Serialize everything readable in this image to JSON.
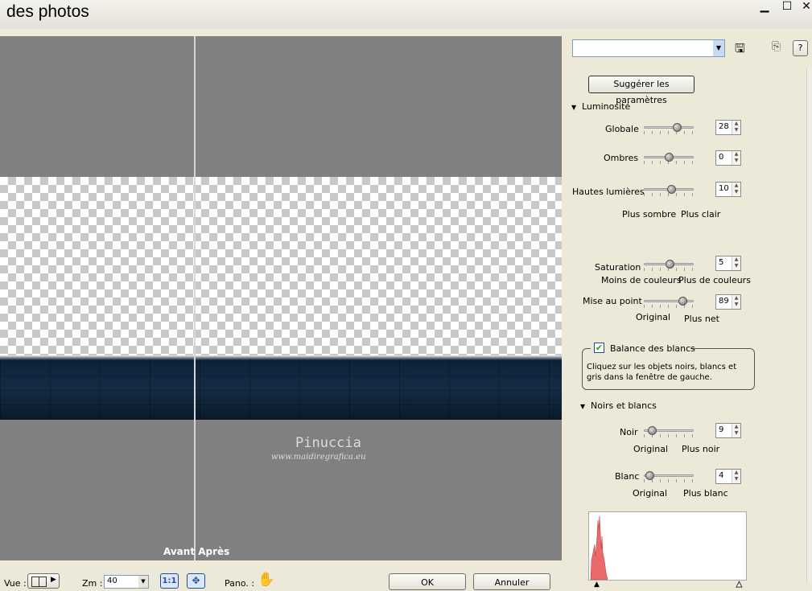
{
  "window": {
    "title": "des photos"
  },
  "preview": {
    "watermark_name": "Pinuccia",
    "watermark_url": "www.maidiregrafica.eu",
    "before_after": "Avant Après"
  },
  "bottom_bar": {
    "view_label": "Vue :",
    "zoom_label": "Zm :",
    "zoom_value": "40",
    "one_to_one": "1:1",
    "pan_label": "Pano. :",
    "ok": "OK",
    "cancel": "Annuler"
  },
  "panel": {
    "preset_value": "",
    "suggest_button": "Suggérer les paramètres",
    "help": "?",
    "luminosity": {
      "section": "Luminosité",
      "global_label": "Globale",
      "global_value": "28",
      "global_level": 0.7,
      "shadows_label": "Ombres",
      "shadows_value": "0",
      "shadows_level": 0.5,
      "highlights_label": "Hautes lumières",
      "highlights_value": "10",
      "highlights_level": 0.56,
      "darker": "Plus sombre",
      "lighter": "Plus clair"
    },
    "saturation": {
      "label": "Saturation",
      "value": "5",
      "level": 0.52,
      "less": "Moins de couleurs",
      "more": "Plus de couleurs"
    },
    "focus": {
      "label": "Mise au point",
      "value": "89",
      "level": 0.85,
      "original": "Original",
      "sharper": "Plus net"
    },
    "white_balance": {
      "label": "Balance des blancs",
      "checked": true,
      "hint": "Cliquez sur les objets noirs, blancs et gris dans la fenêtre de gauche."
    },
    "black_white": {
      "section": "Noirs et blancs",
      "black_label": "Noir",
      "black_value": "9",
      "black_level": 0.1,
      "black_original": "Original",
      "black_more": "Plus noir",
      "white_label": "Blanc",
      "white_value": "4",
      "white_level": 0.04,
      "white_original": "Original",
      "white_more": "Plus blanc"
    }
  }
}
